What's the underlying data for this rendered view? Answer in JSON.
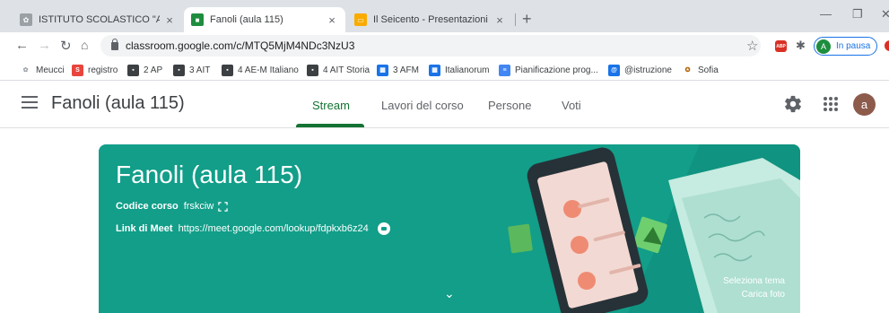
{
  "browser": {
    "tabs": [
      {
        "label": "ISTITUTO SCOLASTICO \"A.MEUCC",
        "close": "×"
      },
      {
        "label": "Fanoli (aula 115)",
        "close": "×"
      },
      {
        "label": "Il Seicento - Presentazioni Googl",
        "close": "×"
      }
    ],
    "new_tab": "+",
    "address": "classroom.google.com/c/MTQ5MjM4NDc3NzU3",
    "profile_status": "In pausa",
    "profile_initial": "A",
    "abp_label": "ABP"
  },
  "bookmarks": [
    {
      "label": "Meucci"
    },
    {
      "label": "registro"
    },
    {
      "label": "2 AP"
    },
    {
      "label": "3 AIT"
    },
    {
      "label": "4 AE-M Italiano"
    },
    {
      "label": "4 AIT Storia"
    },
    {
      "label": "3 AFM"
    },
    {
      "label": "Italianorum"
    },
    {
      "label": "Pianificazione prog..."
    },
    {
      "label": "@istruzione"
    },
    {
      "label": "Sofia"
    }
  ],
  "app": {
    "class_title": "Fanoli (aula 115)",
    "nav": [
      "Stream",
      "Lavori del corso",
      "Persone",
      "Voti"
    ],
    "user_initial": "a"
  },
  "banner": {
    "title": "Fanoli (aula 115)",
    "course_code_label": "Codice corso",
    "course_code": "frskciw",
    "meet_label": "Link di Meet",
    "meet_link": "https://meet.google.com/lookup/fdpkxb6z24",
    "select_theme": "Seleziona tema",
    "upload_photo": "Carica foto"
  },
  "colors": {
    "banner": "#129e89",
    "active_tab": "#137333",
    "avatar": "#8d5b4c"
  }
}
